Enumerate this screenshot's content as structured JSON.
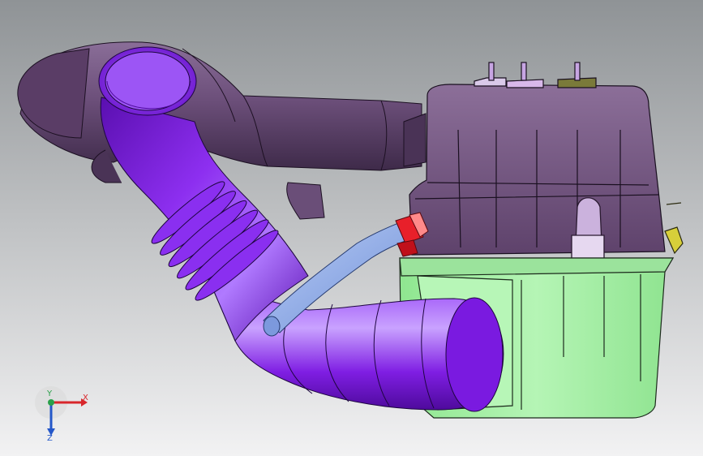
{
  "colors": {
    "background_top": "#8f9396",
    "background_bottom": "#f2f2f3",
    "duct_purple": "#7f1ee3",
    "duct_purple_dark": "#4e0a9c",
    "duct_purple_light": "#b078ff",
    "upper_duct": "#6c4f7a",
    "upper_duct_dark": "#3e2a49",
    "housing_lid": "#7d5f8a",
    "housing_lid_dark": "#4f3558",
    "housing_base": "#a8f0a8",
    "housing_base_dark": "#6fcf72",
    "hose_blue": "#8aa7e6",
    "clamp_red": "#e8202a",
    "axis_x": "#d8262b",
    "axis_y": "#2aa04a",
    "axis_z": "#2457c9"
  },
  "triad": {
    "x_label": "X",
    "y_label": "Y",
    "z_label": "Z",
    "icon": "coordinate-triad-icon"
  }
}
